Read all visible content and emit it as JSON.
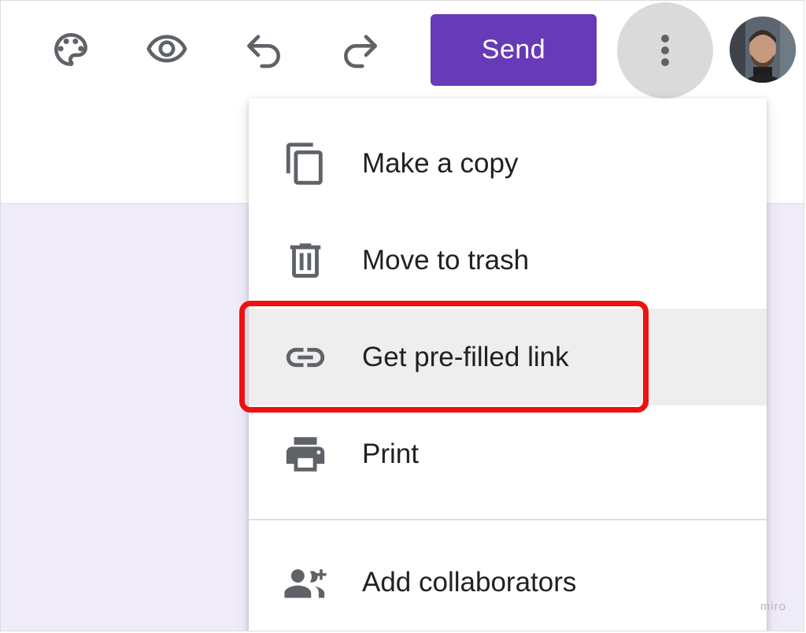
{
  "toolbar": {
    "icons": [
      "palette-icon",
      "eye-icon",
      "undo-icon",
      "redo-icon",
      "more-vert-icon"
    ],
    "send_label": "Send",
    "send_color": "#673ab7"
  },
  "menu": {
    "items": [
      {
        "label": "Make a copy",
        "icon": "copy-icon"
      },
      {
        "label": "Move to trash",
        "icon": "trash-icon"
      },
      {
        "label": "Get pre-filled link",
        "icon": "link-icon",
        "highlighted": true
      },
      {
        "label": "Print",
        "icon": "print-icon"
      },
      {
        "label": "Add collaborators",
        "icon": "add-people-icon"
      }
    ]
  },
  "canvas_color": "#f0ebf8",
  "annotation_color": "#ee1111",
  "watermark": "miro"
}
